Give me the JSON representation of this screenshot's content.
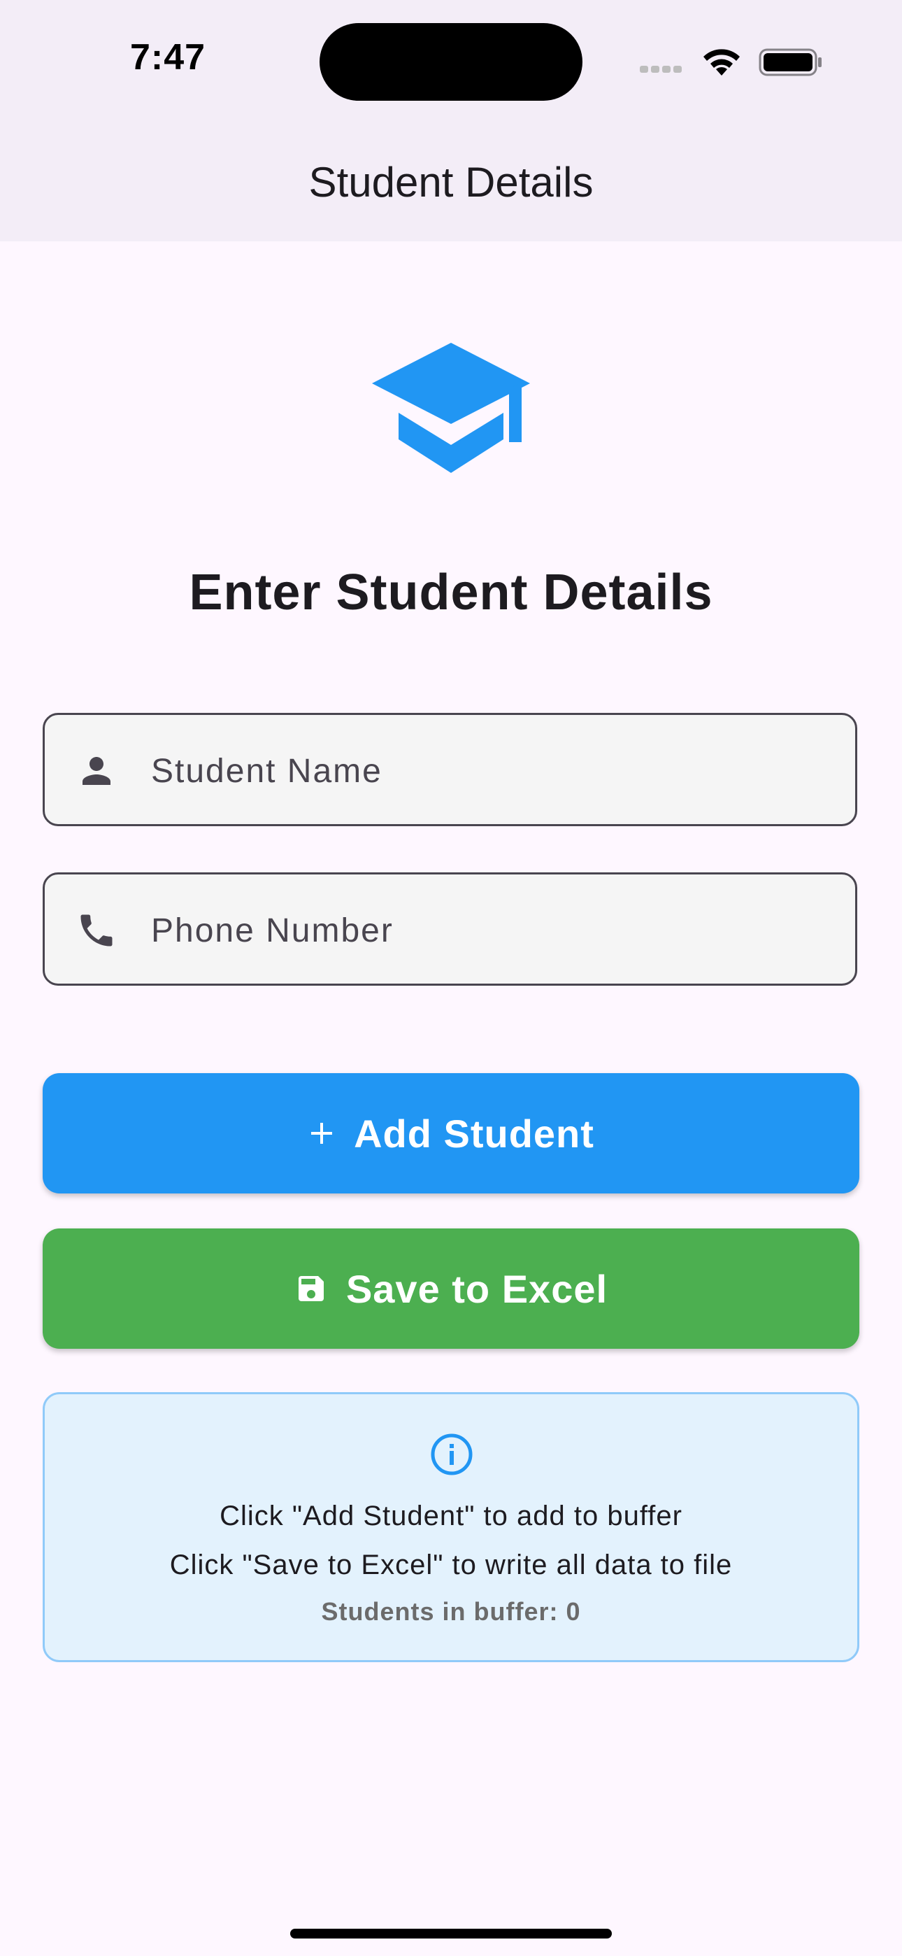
{
  "status_bar": {
    "time": "7:47"
  },
  "app_bar": {
    "title": "Student Details"
  },
  "form": {
    "heading": "Enter Student Details",
    "name_placeholder": "Student Name",
    "name_value": "",
    "phone_placeholder": "Phone Number",
    "phone_value": ""
  },
  "buttons": {
    "add_label": "Add Student",
    "save_label": "Save to Excel"
  },
  "info": {
    "line1": "Click \"Add Student\" to add to buffer",
    "line2": "Click \"Save to Excel\" to write all data to file",
    "count_text": "Students in buffer: 0"
  },
  "icons": {
    "header": "graduation-cap-icon",
    "name": "person-icon",
    "phone": "phone-icon",
    "add": "plus-icon",
    "save": "save-icon",
    "info": "info-icon"
  },
  "colors": {
    "primary_blue": "#2196F3",
    "save_green": "#4CAF50",
    "info_bg": "#E3F2FD",
    "info_border": "#90CAF9",
    "app_bar_bg": "#F3EDF7",
    "page_bg": "#FEF7FF"
  }
}
